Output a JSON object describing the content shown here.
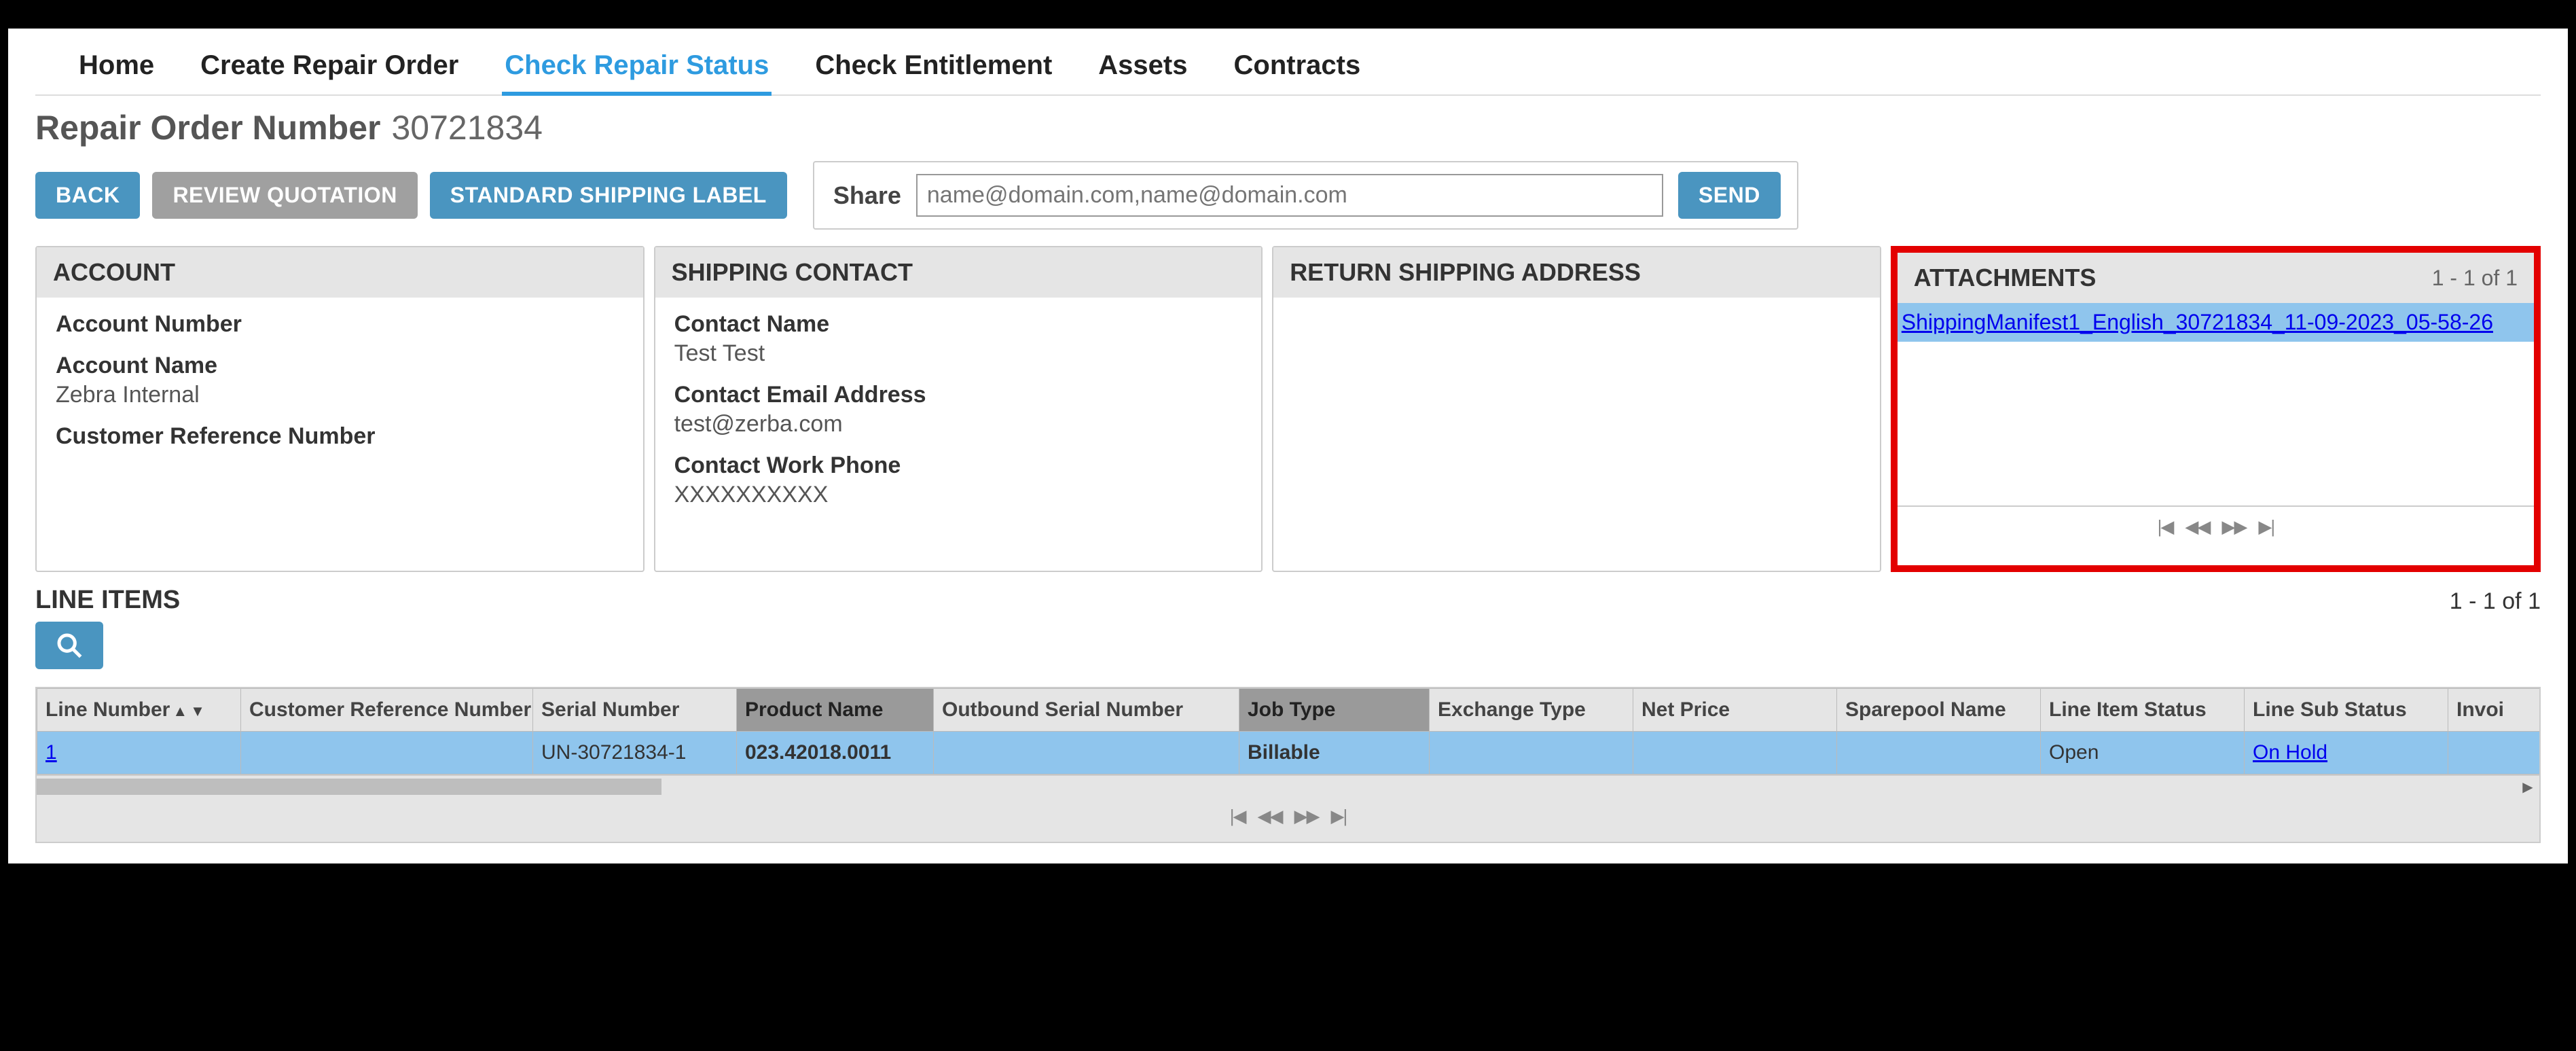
{
  "nav": {
    "items": [
      {
        "label": "Home",
        "active": false
      },
      {
        "label": "Create Repair Order",
        "active": false
      },
      {
        "label": "Check Repair Status",
        "active": true
      },
      {
        "label": "Check Entitlement",
        "active": false
      },
      {
        "label": "Assets",
        "active": false
      },
      {
        "label": "Contracts",
        "active": false
      }
    ]
  },
  "title": {
    "label": "Repair Order Number",
    "number": "30721834"
  },
  "actions": {
    "back": "BACK",
    "review": "REVIEW QUOTATION",
    "ship": "STANDARD SHIPPING LABEL",
    "share_label": "Share",
    "share_placeholder": "name@domain.com,name@domain.com",
    "send": "SEND"
  },
  "panels": {
    "account": {
      "title": "ACCOUNT",
      "acct_num_lbl": "Account Number",
      "acct_num_val": "",
      "acct_name_lbl": "Account Name",
      "acct_name_val": "Zebra Internal",
      "cust_ref_lbl": "Customer Reference Number",
      "cust_ref_val": ""
    },
    "shipping_contact": {
      "title": "SHIPPING CONTACT",
      "name_lbl": "Contact Name",
      "name_val": "Test Test",
      "email_lbl": "Contact Email Address",
      "email_val": "test@zerba.com",
      "phone_lbl": "Contact Work Phone",
      "phone_val": "XXXXXXXXXX"
    },
    "return_addr": {
      "title": "RETURN SHIPPING ADDRESS"
    },
    "attachments": {
      "title": "ATTACHMENTS",
      "count": "1 - 1 of 1",
      "rows": [
        {
          "name": "ShippingManifest1_English_30721834_11-09-2023_05-58-26"
        }
      ]
    }
  },
  "lineitems": {
    "title": "LINE ITEMS",
    "count": "1 - 1 of 1",
    "columns": [
      {
        "label": "Line Number",
        "sort": true
      },
      {
        "label": "Customer Reference Number"
      },
      {
        "label": "Serial Number"
      },
      {
        "label": "Product Name",
        "dark": true
      },
      {
        "label": "Outbound Serial Number"
      },
      {
        "label": "Job Type",
        "dark": true
      },
      {
        "label": "Exchange Type"
      },
      {
        "label": "Net Price"
      },
      {
        "label": "Sparepool Name"
      },
      {
        "label": "Line Item Status"
      },
      {
        "label": "Line Sub Status"
      },
      {
        "label": "Invoi"
      }
    ],
    "rows": [
      {
        "line_number": "1",
        "cust_ref": "",
        "serial": "UN-30721834-1",
        "product": "023.42018.0011",
        "outbound": "",
        "job_type": "Billable",
        "exchange": "",
        "net_price": "",
        "sparepool": "",
        "status": "Open",
        "sub_status": "On Hold",
        "invoice": ""
      }
    ]
  },
  "pager_glyphs": {
    "first": "|◀",
    "prev": "◀◀",
    "next": "▶▶",
    "last": "▶|"
  }
}
